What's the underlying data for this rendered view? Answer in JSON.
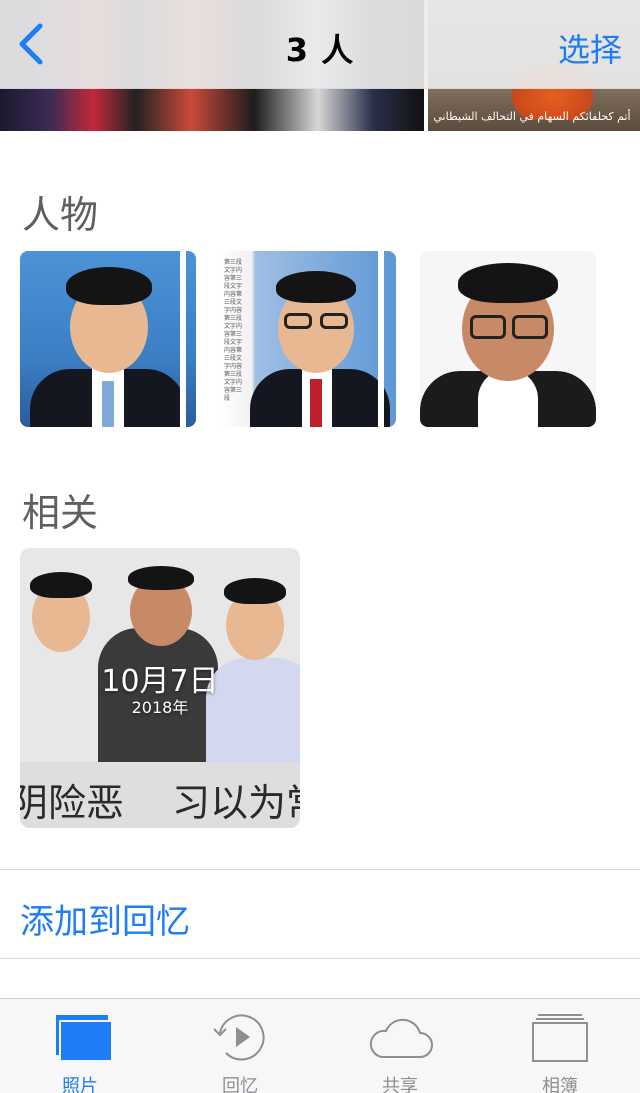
{
  "nav": {
    "title": "3 人",
    "action": "选择"
  },
  "top_thumbnails": {
    "caption_right": "أتم كحلفائكم السهام في التحالف الشيطاني"
  },
  "sections": {
    "people_title": "人物",
    "related_title": "相关"
  },
  "related_card": {
    "date": "10月7日",
    "year": "2018年",
    "caption_left": "阴险恶",
    "caption_right": "习以为常"
  },
  "add_to_memories": "添加到回忆",
  "tabs": [
    {
      "label": "照片",
      "icon": "photos-icon",
      "active": true
    },
    {
      "label": "回忆",
      "icon": "memories-icon",
      "active": false
    },
    {
      "label": "共享",
      "icon": "cloud-icon",
      "active": false
    },
    {
      "label": "相簿",
      "icon": "albums-icon",
      "active": false
    }
  ],
  "colors": {
    "accent": "#1e7cf5",
    "tab_inactive": "#8e8e93",
    "section_title": "#5f5f5f"
  }
}
